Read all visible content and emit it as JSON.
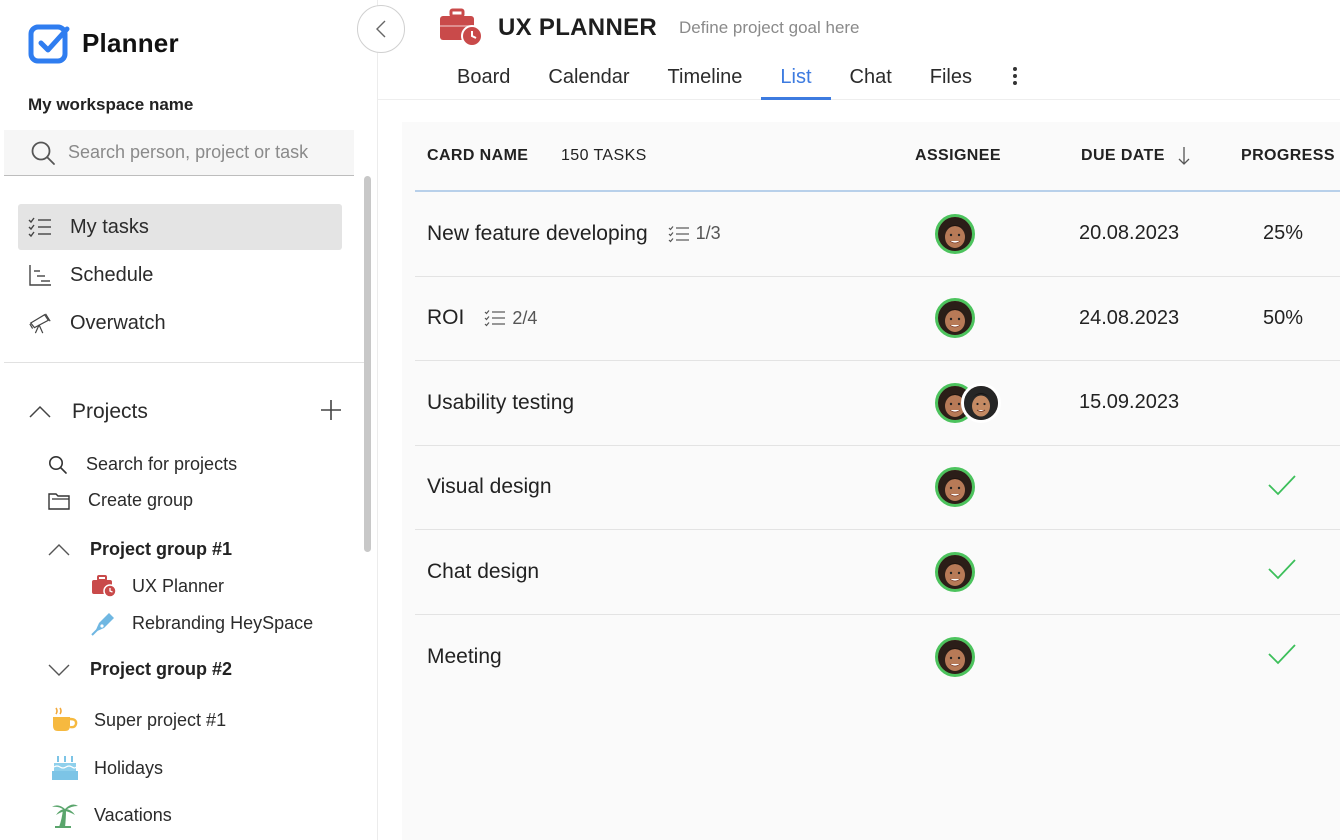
{
  "app": {
    "name": "Planner",
    "workspace": "My workspace name",
    "search_placeholder": "Search person, project or task"
  },
  "nav": [
    {
      "label": "My tasks",
      "icon": "checklist-icon",
      "active": true
    },
    {
      "label": "Schedule",
      "icon": "schedule-icon",
      "active": false
    },
    {
      "label": "Overwatch",
      "icon": "telescope-icon",
      "active": false
    }
  ],
  "projects": {
    "label": "Projects",
    "links": [
      {
        "label": "Search for projects",
        "icon": "search-icon"
      },
      {
        "label": "Create group",
        "icon": "folder-icon"
      }
    ],
    "groups": [
      {
        "label": "Project group #1",
        "expanded": true,
        "items": [
          {
            "label": "UX Planner",
            "icon": "briefcase-clock-icon"
          },
          {
            "label": "Rebranding HeySpace",
            "icon": "pen-icon"
          }
        ]
      },
      {
        "label": "Project group #2",
        "expanded": false,
        "items": []
      }
    ],
    "items": [
      {
        "label": "Super project #1",
        "icon": "coffee-icon"
      },
      {
        "label": "Holidays",
        "icon": "cake-icon"
      },
      {
        "label": "Vacations",
        "icon": "palm-tree-icon"
      }
    ]
  },
  "header": {
    "title": "UX PLANNER",
    "goal_placeholder": "Define project goal here",
    "tabs": [
      {
        "label": "Board",
        "active": false
      },
      {
        "label": "Calendar",
        "active": false
      },
      {
        "label": "Timeline",
        "active": false
      },
      {
        "label": "List",
        "active": true
      },
      {
        "label": "Chat",
        "active": false
      },
      {
        "label": "Files",
        "active": false
      }
    ]
  },
  "table": {
    "columns": {
      "name": "CARD NAME",
      "count": "150 TASKS",
      "assignee": "ASSIGNEE",
      "due": "DUE DATE",
      "progress": "PROGRESS"
    },
    "rows": [
      {
        "name": "New feature developing",
        "subtasks": "1/3",
        "assignees": 1,
        "due": "20.08.2023",
        "progress": "25%",
        "done": false
      },
      {
        "name": "ROI",
        "subtasks": "2/4",
        "assignees": 1,
        "due": "24.08.2023",
        "progress": "50%",
        "done": false
      },
      {
        "name": "Usability testing",
        "subtasks": "",
        "assignees": 2,
        "due": "15.09.2023",
        "progress": "",
        "done": false
      },
      {
        "name": "Visual design",
        "subtasks": "",
        "assignees": 1,
        "due": "",
        "progress": "",
        "done": true
      },
      {
        "name": "Chat design",
        "subtasks": "",
        "assignees": 1,
        "due": "",
        "progress": "",
        "done": true
      },
      {
        "name": "Meeting",
        "subtasks": "",
        "assignees": 1,
        "due": "",
        "progress": "",
        "done": true
      }
    ]
  },
  "colors": {
    "accent": "#3d7be0",
    "logo": "#2f7df0",
    "project_red": "#c94a4a",
    "check_green": "#3cbf5a",
    "avatar_ring": "#4cc35d"
  }
}
